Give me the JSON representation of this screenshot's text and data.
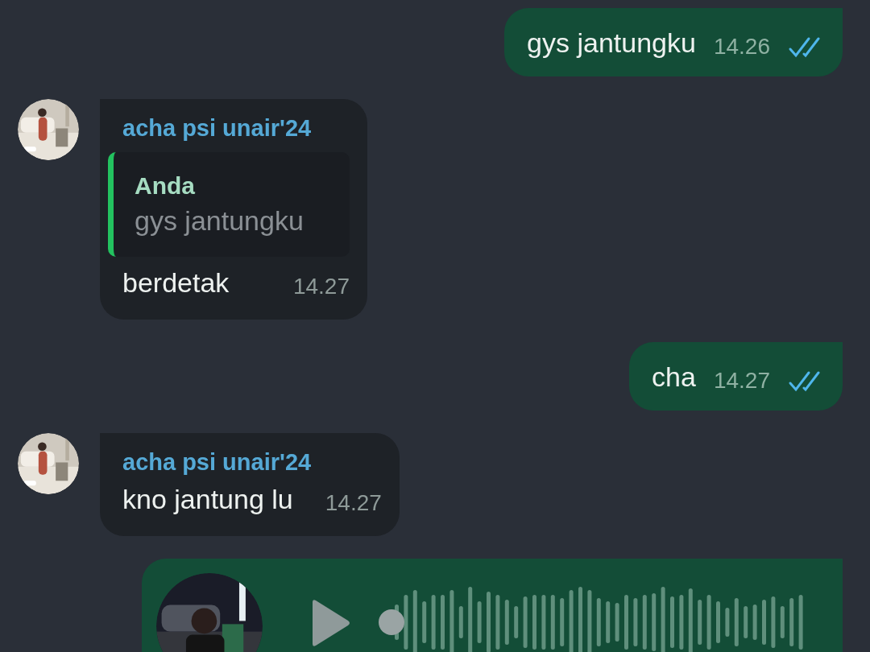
{
  "messages": [
    {
      "kind": "out",
      "text": "gys jantungku",
      "time": "14.26",
      "read": true
    },
    {
      "kind": "in",
      "sender": "acha psi unair'24",
      "reply": {
        "author": "Anda",
        "text": "gys jantungku"
      },
      "text": "berdetak",
      "time": "14.27"
    },
    {
      "kind": "out",
      "text": "cha",
      "time": "14.27",
      "read": true
    },
    {
      "kind": "in",
      "sender": "acha psi unair'24",
      "text": "kno jantung lu",
      "time": "14.27"
    },
    {
      "kind": "voice",
      "level": 0
    }
  ]
}
